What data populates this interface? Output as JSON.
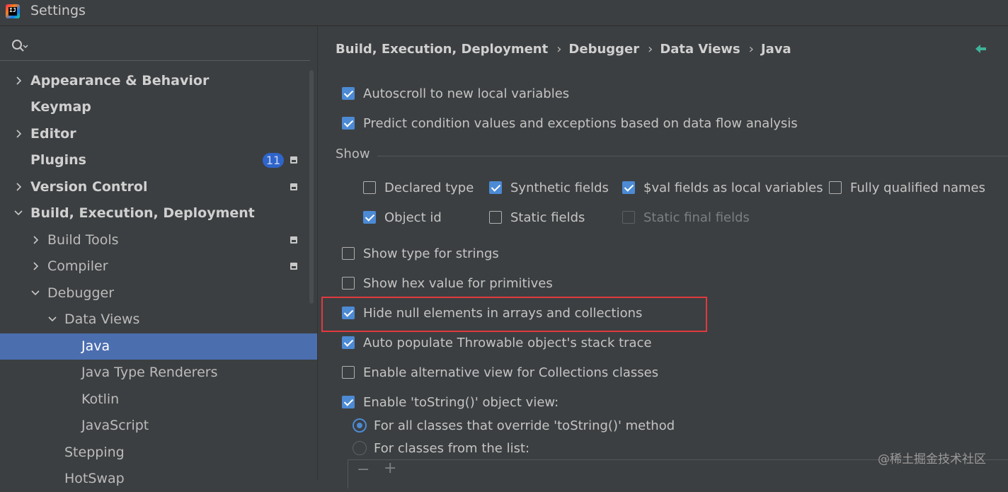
{
  "window": {
    "title": "Settings"
  },
  "sidebar": {
    "search_placeholder": "",
    "items": [
      {
        "label": "Appearance & Behavior",
        "expanded": false
      },
      {
        "label": "Keymap"
      },
      {
        "label": "Editor",
        "expanded": false
      },
      {
        "label": "Plugins",
        "badge": "11"
      },
      {
        "label": "Version Control",
        "expanded": false
      },
      {
        "label": "Build, Execution, Deployment",
        "expanded": true
      },
      {
        "label": "Build Tools",
        "expanded": false
      },
      {
        "label": "Compiler",
        "expanded": false
      },
      {
        "label": "Debugger",
        "expanded": true
      },
      {
        "label": "Data Views",
        "expanded": true
      },
      {
        "label": "Java",
        "selected": true
      },
      {
        "label": "Java Type Renderers"
      },
      {
        "label": "Kotlin"
      },
      {
        "label": "JavaScript"
      },
      {
        "label": "Stepping"
      },
      {
        "label": "HotSwap"
      }
    ]
  },
  "breadcrumb": [
    "Build, Execution, Deployment",
    "Debugger",
    "Data Views",
    "Java"
  ],
  "options": {
    "autoscroll": {
      "label": "Autoscroll to new local variables",
      "checked": true
    },
    "predict": {
      "label": "Predict condition values and exceptions based on data flow analysis",
      "checked": true
    },
    "show_section": "Show",
    "declared_type": {
      "label": "Declared type",
      "checked": false
    },
    "synthetic_fields": {
      "label": "Synthetic fields",
      "checked": true
    },
    "val_fields": {
      "label": "$val fields as local variables",
      "checked": true
    },
    "fully_qualified": {
      "label": "Fully qualified names",
      "checked": false
    },
    "object_id": {
      "label": "Object id",
      "checked": true
    },
    "static_fields": {
      "label": "Static fields",
      "checked": false
    },
    "static_final_fields": {
      "label": "Static final fields",
      "checked": false,
      "disabled": true
    },
    "type_strings": {
      "label": "Show type for strings",
      "checked": false
    },
    "hex_primitives": {
      "label": "Show hex value for primitives",
      "checked": false
    },
    "hide_null": {
      "label": "Hide null elements in arrays and collections",
      "checked": true
    },
    "auto_populate": {
      "label": "Auto populate Throwable object's stack trace",
      "checked": true
    },
    "alt_view": {
      "label": "Enable alternative view for Collections classes",
      "checked": false
    },
    "tostring": {
      "label": "Enable 'toString()' object view:",
      "checked": true
    },
    "radio_all": {
      "label": "For all classes that override 'toString()' method",
      "selected": true
    },
    "radio_list": {
      "label": "For classes from the list:",
      "selected": false
    }
  },
  "list_toolbar": {
    "remove": "−",
    "add": "+"
  },
  "watermark": "@稀土掘金技术社区",
  "colors": {
    "accent": "#4c8ad4",
    "selection": "#4b6eaf",
    "highlight_border": "#e0393e",
    "background": "#3c3f41"
  }
}
